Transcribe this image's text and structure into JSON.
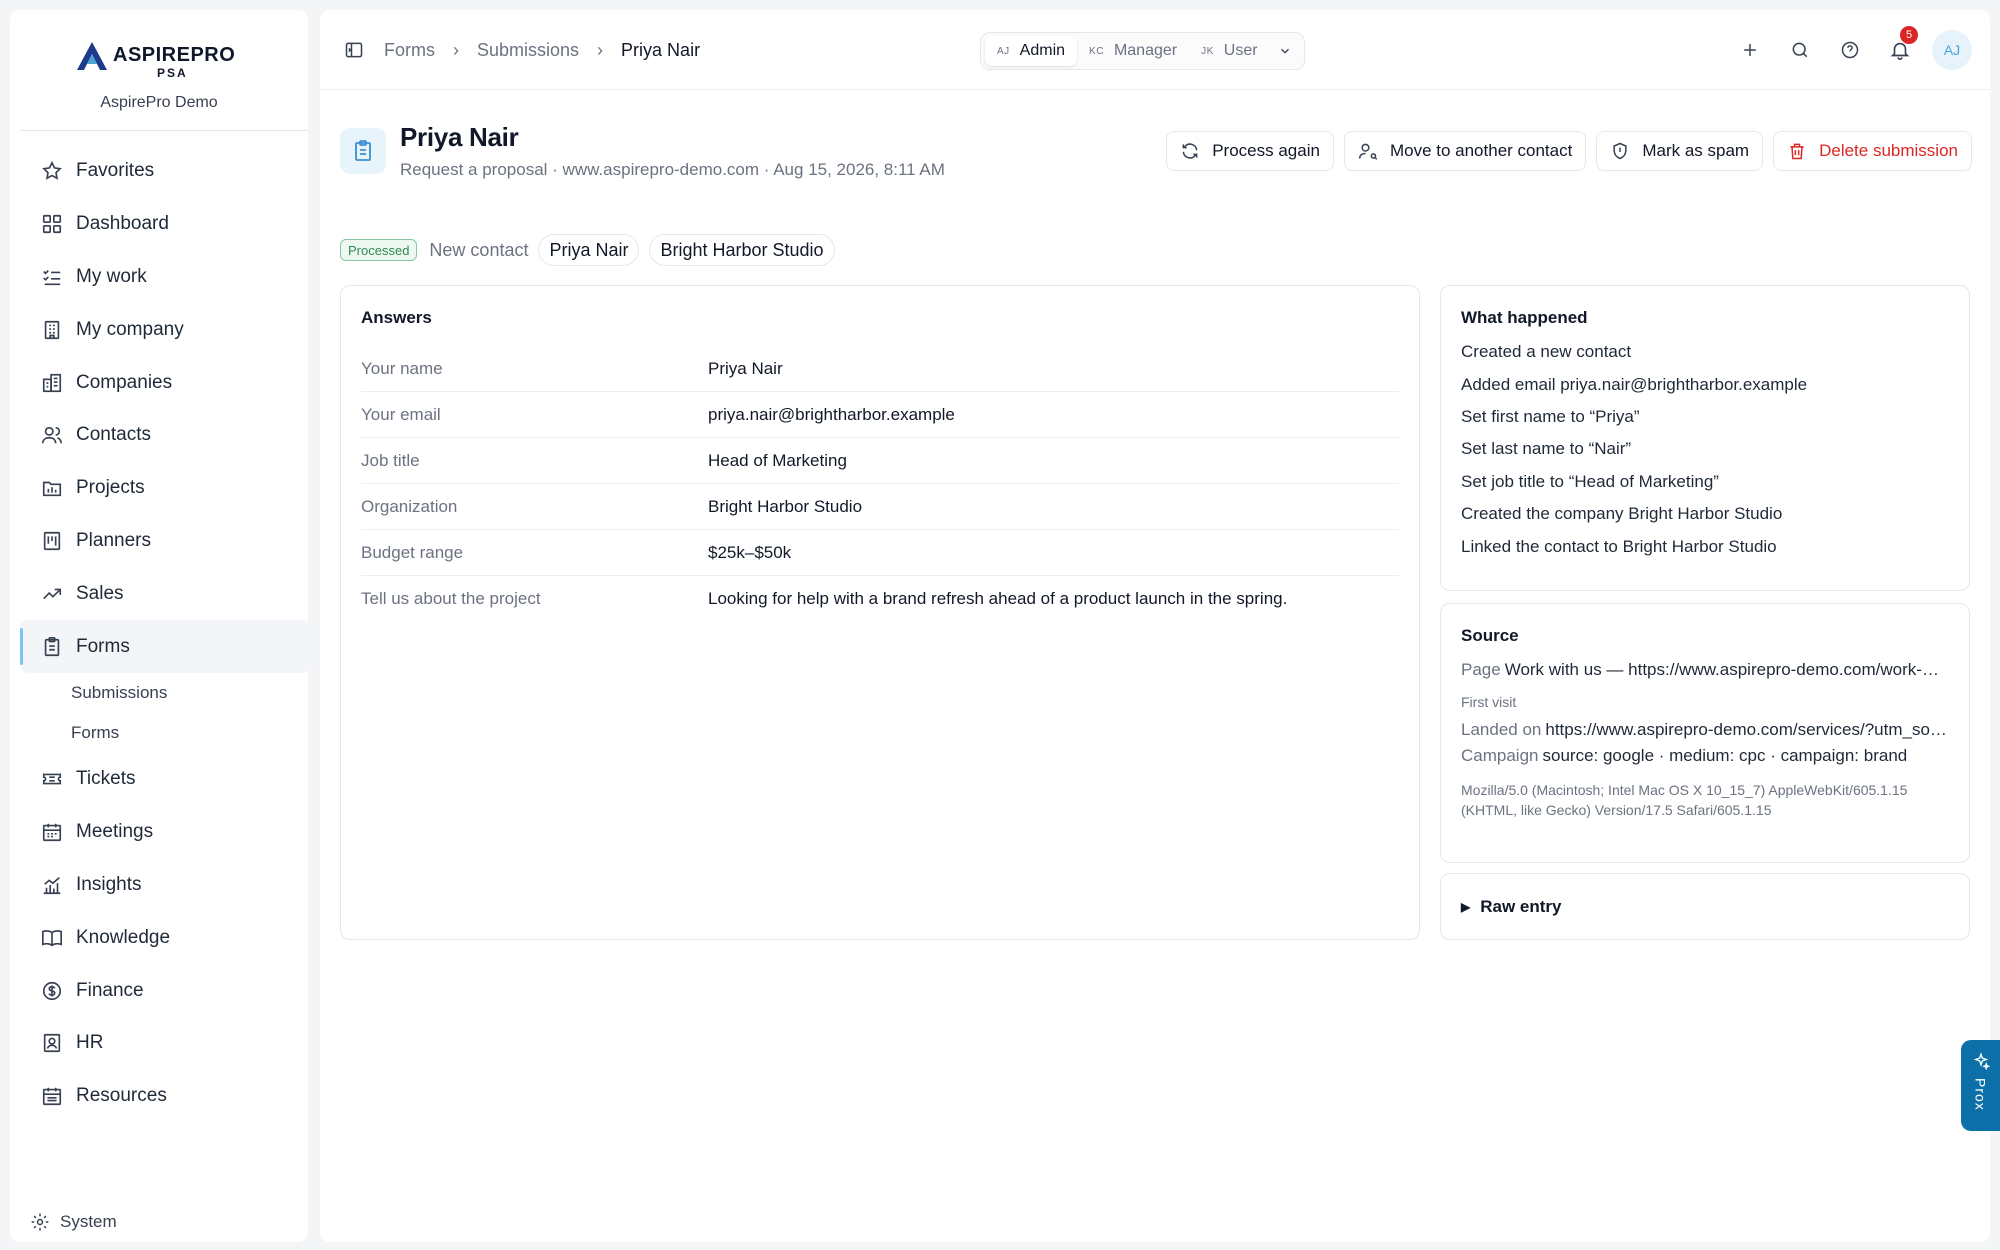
{
  "brand": {
    "name": "ASPIREPRO",
    "sub": "PSA",
    "org": "AspirePro Demo"
  },
  "sidebar": {
    "items": [
      {
        "label": "Favorites",
        "icon": "star-icon"
      },
      {
        "label": "Dashboard",
        "icon": "grid-icon"
      },
      {
        "label": "My work",
        "icon": "list-check-icon"
      },
      {
        "label": "My company",
        "icon": "building-icon"
      },
      {
        "label": "Companies",
        "icon": "buildings-icon"
      },
      {
        "label": "Contacts",
        "icon": "users-icon"
      },
      {
        "label": "Projects",
        "icon": "folder-chart-icon"
      },
      {
        "label": "Planners",
        "icon": "planner-icon"
      },
      {
        "label": "Sales",
        "icon": "trend-up-icon"
      },
      {
        "label": "Forms",
        "icon": "clipboard-icon",
        "active": true
      },
      {
        "label": "Tickets",
        "icon": "ticket-icon"
      },
      {
        "label": "Meetings",
        "icon": "calendar-icon"
      },
      {
        "label": "Insights",
        "icon": "bar-chart-icon"
      },
      {
        "label": "Knowledge",
        "icon": "book-icon"
      },
      {
        "label": "Finance",
        "icon": "dollar-icon"
      },
      {
        "label": "HR",
        "icon": "id-badge-icon"
      },
      {
        "label": "Resources",
        "icon": "calendar-grid-icon"
      }
    ],
    "forms_sub": [
      "Submissions",
      "Forms"
    ],
    "system": "System"
  },
  "breadcrumb": {
    "items": [
      "Forms",
      "Submissions"
    ],
    "current": "Priya Nair"
  },
  "roles": [
    {
      "initials": "AJ",
      "label": "Admin",
      "active": true
    },
    {
      "initials": "KC",
      "label": "Manager"
    },
    {
      "initials": "JK",
      "label": "User"
    }
  ],
  "notifications": {
    "count": "5"
  },
  "avatar": "AJ",
  "submission": {
    "title": "Priya Nair",
    "subtitle": "Request a proposal · www.aspirepro-demo.com · Aug 15, 2026, 8:11 AM",
    "status": "Processed",
    "tag_prefix": "New contact",
    "pills": [
      "Priya Nair",
      "Bright Harbor Studio"
    ]
  },
  "actions": {
    "process_again": "Process again",
    "move": "Move to another contact",
    "spam": "Mark as spam",
    "delete": "Delete submission"
  },
  "answers": {
    "title": "Answers",
    "rows": [
      {
        "q": "Your name",
        "a": "Priya Nair"
      },
      {
        "q": "Your email",
        "a": "priya.nair@brightharbor.example"
      },
      {
        "q": "Job title",
        "a": "Head of Marketing"
      },
      {
        "q": "Organization",
        "a": "Bright Harbor Studio"
      },
      {
        "q": "Budget range",
        "a": "$25k–$50k"
      },
      {
        "q": "Tell us about the project",
        "a": "Looking for help with a brand refresh ahead of a product launch in the spring."
      }
    ]
  },
  "what_happened": {
    "title": "What happened",
    "items": [
      "Created a new contact",
      "Added email priya.nair@brightharbor.example",
      "Set first name to “Priya”",
      "Set last name to “Nair”",
      "Set job title to “Head of Marketing”",
      "Created the company Bright Harbor Studio",
      "Linked the contact to Bright Harbor Studio"
    ]
  },
  "source": {
    "title": "Source",
    "page_label": "Page",
    "page_value": "Work with us — https://www.aspirepro-demo.com/work-with-us",
    "first_visit": "First visit",
    "landed_label": "Landed on",
    "landed_value": "https://www.aspirepro-demo.com/services/?utm_source=google",
    "campaign_label": "Campaign",
    "campaign_value": "source: google · medium: cpc · campaign: brand",
    "ua_line1": "Mozilla/5.0 (Macintosh; Intel Mac OS X 10_15_7) AppleWebKit/605.1.15",
    "ua_line2": "(KHTML, like Gecko) Version/17.5 Safari/605.1.15"
  },
  "raw_entry": "Raw entry",
  "prox": "Prox",
  "colors": {
    "accent": "#0d6fa8",
    "danger": "#dc2626",
    "success": "#2f8a52"
  }
}
